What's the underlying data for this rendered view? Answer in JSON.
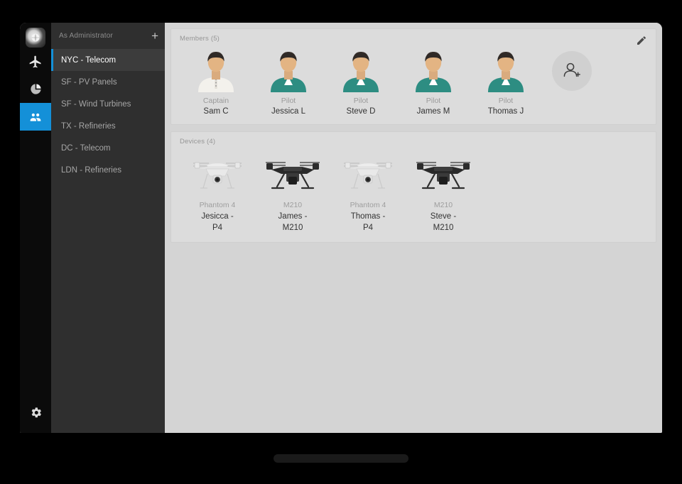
{
  "app": {
    "logo_icon": "drone-globe-logo-icon",
    "accent_color": "#1490d8",
    "sidebar_bg": "#2f2f2f",
    "content_bg": "#d4d4d4",
    "card_bg": "#dcdcdc"
  },
  "rail": {
    "items": [
      {
        "icon": "airplane-icon",
        "name": "flights",
        "active": false
      },
      {
        "icon": "pie-chart-icon",
        "name": "analytics",
        "active": false
      },
      {
        "icon": "people-group-icon",
        "name": "team",
        "active": true
      }
    ],
    "settings": {
      "icon": "gear-icon",
      "name": "settings"
    }
  },
  "sidebar": {
    "header_label": "As Administrator",
    "add_button_label": "+",
    "projects": [
      {
        "label": "NYC - Telecom",
        "selected": true
      },
      {
        "label": "SF - PV Panels",
        "selected": false
      },
      {
        "label": "SF - Wind Turbines",
        "selected": false
      },
      {
        "label": "TX - Refineries",
        "selected": false
      },
      {
        "label": "DC - Telecom",
        "selected": false
      },
      {
        "label": "LDN - Refineries",
        "selected": false
      }
    ]
  },
  "members_card": {
    "title": "Members (5)",
    "edit_icon": "pencil-edit-icon",
    "add_member_icon": "add-person-icon",
    "members": [
      {
        "role": "Captain",
        "name": "Sam C",
        "shirt": "white"
      },
      {
        "role": "Pilot",
        "name": "Jessica L",
        "shirt": "teal"
      },
      {
        "role": "Pilot",
        "name": "Steve D",
        "shirt": "teal"
      },
      {
        "role": "Pilot",
        "name": "James M",
        "shirt": "teal"
      },
      {
        "role": "Pilot",
        "name": "Thomas J",
        "shirt": "teal"
      }
    ]
  },
  "devices_card": {
    "title": "Devices (4)",
    "devices": [
      {
        "model": "Phantom 4",
        "name": "Jesicca - P4",
        "type": "white-quadcopter"
      },
      {
        "model": "M210",
        "name": "James - M210",
        "type": "black-quadcopter"
      },
      {
        "model": "Phantom 4",
        "name": "Thomas - P4",
        "type": "white-quadcopter"
      },
      {
        "model": "M210",
        "name": "Steve - M210",
        "type": "black-quadcopter"
      }
    ]
  }
}
